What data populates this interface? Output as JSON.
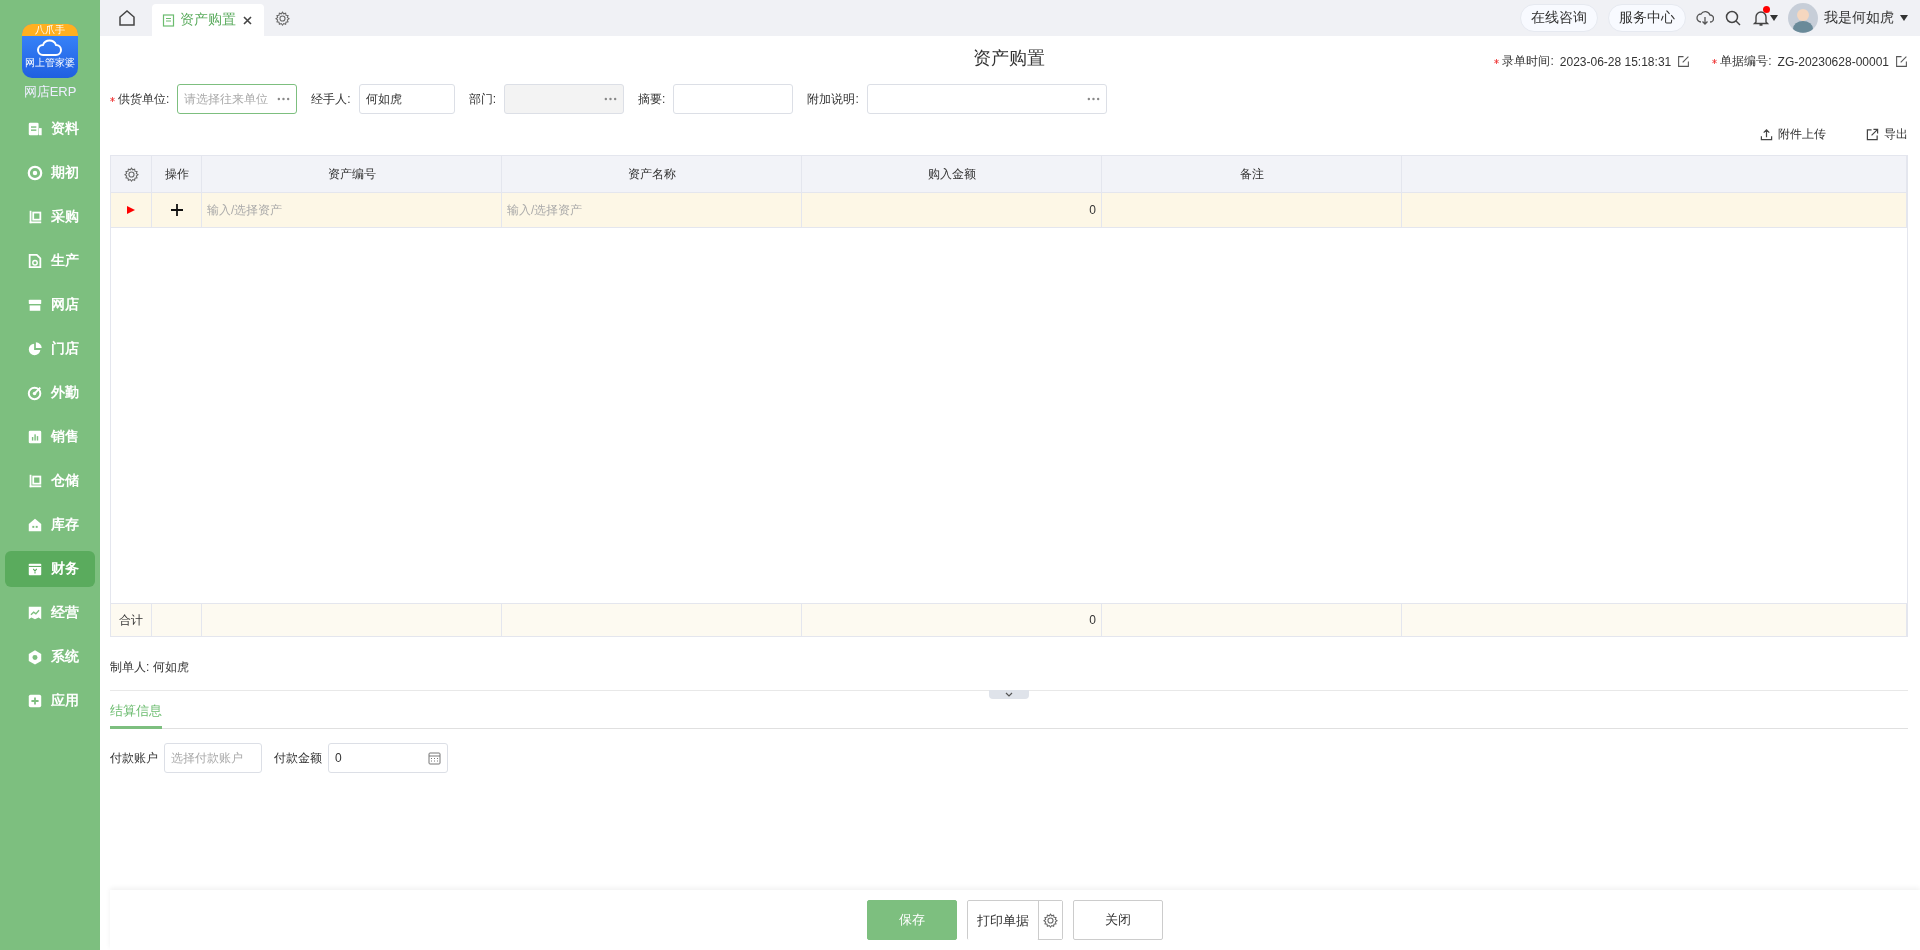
{
  "sidebar": {
    "logo": {
      "badge": "八爪手",
      "caption": "网上管家婆"
    },
    "app_name": "网店ERP",
    "items": [
      {
        "label": "资料",
        "selected": false
      },
      {
        "label": "期初",
        "selected": false
      },
      {
        "label": "采购",
        "selected": false
      },
      {
        "label": "生产",
        "selected": false
      },
      {
        "label": "网店",
        "selected": false
      },
      {
        "label": "门店",
        "selected": false
      },
      {
        "label": "外勤",
        "selected": false
      },
      {
        "label": "销售",
        "selected": false
      },
      {
        "label": "仓储",
        "selected": false
      },
      {
        "label": "库存",
        "selected": false
      },
      {
        "label": "财务",
        "selected": true
      },
      {
        "label": "经营",
        "selected": false
      },
      {
        "label": "系统",
        "selected": false
      },
      {
        "label": "应用",
        "selected": false
      }
    ]
  },
  "topbar": {
    "tabs": [
      {
        "label": "资产购置",
        "selected": true
      }
    ],
    "links": [
      "在线咨询",
      "服务中心"
    ],
    "notifications": {
      "unread": true
    },
    "user": "我是何如虎"
  },
  "page": {
    "title": "资产购置",
    "meta": [
      {
        "label": "录单时间:",
        "value": "2023-06-28 15:18:31",
        "required": true
      },
      {
        "label": "单据编号:",
        "value": "ZG-20230628-00001",
        "required": true
      }
    ],
    "fields": [
      {
        "label": "供货单位:",
        "required": true,
        "placeholder": "请选择往来单位",
        "focused": true,
        "disabled": false,
        "picker": true
      },
      {
        "label": "经手人:",
        "required": false,
        "value": "何如虎",
        "focused": false,
        "disabled": false,
        "picker": false
      },
      {
        "label": "部门:",
        "required": false,
        "focused": false,
        "disabled": true,
        "picker": true
      },
      {
        "label": "摘要:",
        "required": false,
        "focused": false,
        "disabled": false,
        "picker": false
      },
      {
        "label": "附加说明:",
        "required": false,
        "focused": false,
        "disabled": false,
        "picker": true
      }
    ],
    "actions": [
      "附件上传",
      "导出"
    ]
  },
  "table": {
    "columns": [
      "操作",
      "资产编号",
      "资产名称",
      "购入金额",
      "备注"
    ],
    "rows": [
      {
        "selected": true,
        "asset_code_placeholder": "输入/选择资产",
        "asset_name_placeholder": "输入/选择资产",
        "amount": "0"
      }
    ],
    "totals": {
      "label": "合计",
      "amount": "0"
    }
  },
  "maker": {
    "label": "制单人:",
    "value": "何如虎"
  },
  "settlement": {
    "tabs": [
      {
        "label": "结算信息",
        "selected": true
      }
    ],
    "account": {
      "label": "付款账户",
      "placeholder": "选择付款账户"
    },
    "amount": {
      "label": "付款金额",
      "value": "0"
    }
  },
  "footer": {
    "buttons": [
      {
        "label": "保存",
        "kind": "primary"
      },
      {
        "label": "打印单据",
        "kind": "split"
      },
      {
        "label": "关闭",
        "kind": "plain"
      }
    ]
  }
}
